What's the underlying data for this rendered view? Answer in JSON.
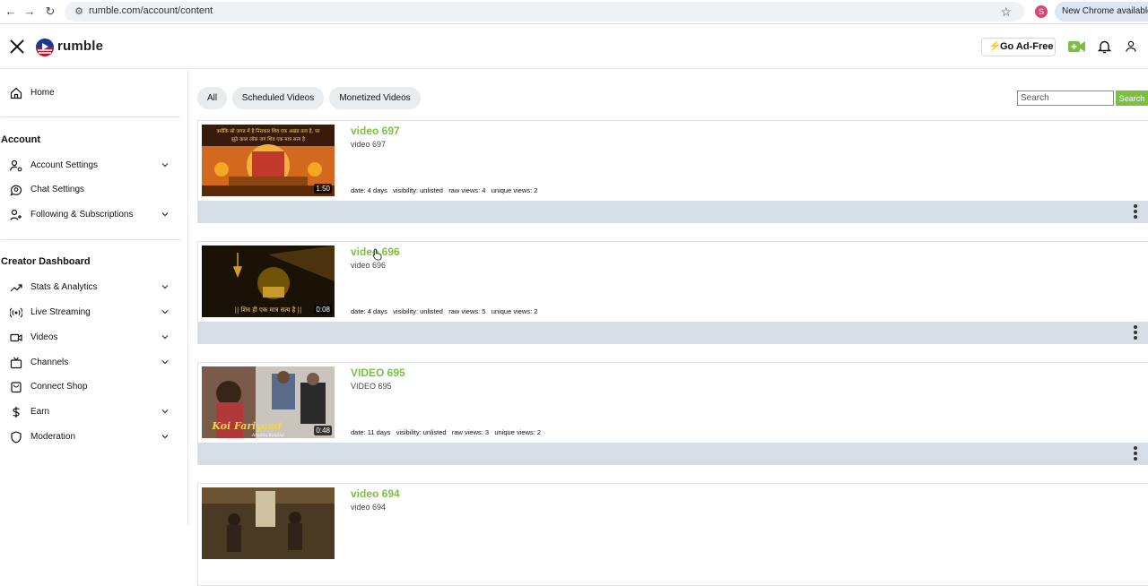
{
  "browser": {
    "url": "rumble.com/account/content",
    "profile_initial": "S",
    "update_label": "New Chrome available"
  },
  "header": {
    "logo_text": "rumble",
    "ad_free_label": "Go Ad-Free",
    "brand_color": "#7bc043"
  },
  "sidebar": {
    "home": "Home",
    "account_heading": "Account",
    "account_items": [
      {
        "label": "Account Settings",
        "icon": "user-settings-icon",
        "expandable": true
      },
      {
        "label": "Chat Settings",
        "icon": "chat-settings-icon",
        "expandable": false
      },
      {
        "label": "Following & Subscriptions",
        "icon": "user-plus-icon",
        "expandable": true
      }
    ],
    "creator_heading": "Creator Dashboard",
    "creator_items": [
      {
        "label": "Stats & Analytics",
        "icon": "trending-icon",
        "expandable": true
      },
      {
        "label": "Live Streaming",
        "icon": "broadcast-icon",
        "expandable": true
      },
      {
        "label": "Videos",
        "icon": "video-icon",
        "expandable": true
      },
      {
        "label": "Channels",
        "icon": "channel-icon",
        "expandable": true
      },
      {
        "label": "Connect Shop",
        "icon": "shop-icon",
        "expandable": false
      },
      {
        "label": "Earn",
        "icon": "dollar-icon",
        "expandable": true
      },
      {
        "label": "Moderation",
        "icon": "shield-icon",
        "expandable": true
      }
    ]
  },
  "filters": {
    "all": "All",
    "scheduled": "Scheduled Videos",
    "monetized": "Monetized Videos"
  },
  "search": {
    "placeholder": "Search",
    "button": "Search"
  },
  "videos": [
    {
      "title": "video 697",
      "description": "video 697",
      "duration": "1:50",
      "meta": "date: 4 days   visibility: unlisted   raw views: 4   unique views: 2"
    },
    {
      "title": "video 696",
      "description": "video 696",
      "duration": "0:08",
      "meta": "date: 4 days   visibility: unlisted   raw views: 5   unique views: 2"
    },
    {
      "title": "VIDEO 695",
      "description": "VIDEO 695",
      "duration": "0:48",
      "meta": "date: 11 days   visibility: unlisted   raw views: 3   unique views: 2"
    },
    {
      "title": "video 694",
      "description": "video 694",
      "duration": "",
      "meta": ""
    }
  ],
  "thumbnail_text": {
    "v697_line1": "क्योंकि सो जगत में है निराकार शिव एक अखंड तत्व है, पर",
    "v697_line2": "झूठे काल लोक जग शिव एक मात्र सत्य है",
    "v696_caption": "|| शिव ही एक मात्र सत्य है ||",
    "v695_caption": "Koi Fariyaad",
    "v695_credit": "Arunita Kanjilal"
  }
}
